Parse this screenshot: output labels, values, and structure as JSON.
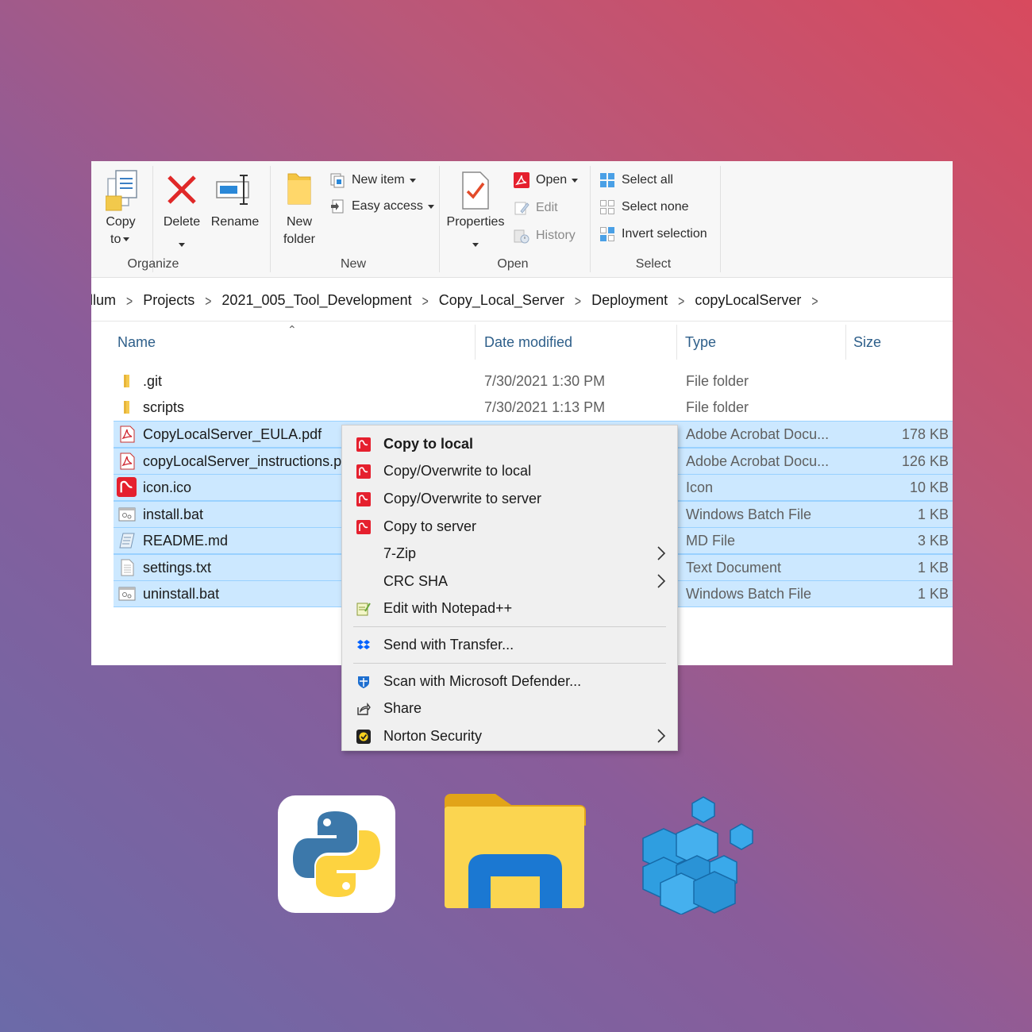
{
  "ribbon": {
    "organize": {
      "copy_to_line1": "Copy",
      "copy_to_line2": "to",
      "delete": "Delete",
      "rename": "Rename",
      "group_label": "Organize"
    },
    "new": {
      "new_item": "New item",
      "easy_access": "Easy access",
      "new_folder_line1": "New",
      "new_folder_line2": "folder",
      "group_label": "New"
    },
    "open": {
      "properties": "Properties",
      "open": "Open",
      "edit": "Edit",
      "history": "History",
      "group_label": "Open"
    },
    "select": {
      "select_all": "Select all",
      "select_none": "Select none",
      "invert_selection": "Invert selection",
      "group_label": "Select"
    }
  },
  "breadcrumb": [
    "llum",
    "Projects",
    "2021_005_Tool_Development",
    "Copy_Local_Server",
    "Deployment",
    "copyLocalServer"
  ],
  "columns": {
    "name": "Name",
    "date": "Date modified",
    "type": "Type",
    "size": "Size"
  },
  "files": [
    {
      "name": ".git",
      "date": "7/30/2021 1:30 PM",
      "type": "File folder",
      "size": "",
      "icon": "folder-icon",
      "selected": false
    },
    {
      "name": "scripts",
      "date": "7/30/2021 1:13 PM",
      "type": "File folder",
      "size": "",
      "icon": "folder-icon",
      "selected": false
    },
    {
      "name": "CopyLocalServer_EULA.pdf",
      "date": "",
      "type": "Adobe Acrobat Docu...",
      "size": "178 KB",
      "icon": "pdf-icon",
      "selected": true
    },
    {
      "name": "copyLocalServer_instructions.p",
      "date": "",
      "type": "Adobe Acrobat Docu...",
      "size": "126 KB",
      "icon": "pdf-icon",
      "selected": true
    },
    {
      "name": "icon.ico",
      "date": "",
      "type": "Icon",
      "size": "10 KB",
      "icon": "ico-icon",
      "selected": true
    },
    {
      "name": "install.bat",
      "date": "",
      "type": "Windows Batch File",
      "size": "1 KB",
      "icon": "batch-icon",
      "selected": true
    },
    {
      "name": "README.md",
      "date": "",
      "type": "MD File",
      "size": "3 KB",
      "icon": "markdown-icon",
      "selected": true
    },
    {
      "name": "settings.txt",
      "date": "",
      "type": "Text Document",
      "size": "1 KB",
      "icon": "text-icon",
      "selected": true
    },
    {
      "name": "uninstall.bat",
      "date": "",
      "type": "Windows Batch File",
      "size": "1 KB",
      "icon": "batch-icon",
      "selected": true
    }
  ],
  "context_menu": {
    "copy_to_local": "Copy to local",
    "copy_overwrite_local": "Copy/Overwrite to local",
    "copy_overwrite_server": "Copy/Overwrite to server",
    "copy_to_server": "Copy to server",
    "zip": "7-Zip",
    "crc_sha": "CRC SHA",
    "edit_notepad": "Edit with Notepad++",
    "send_transfer": "Send with Transfer...",
    "scan_defender": "Scan with Microsoft Defender...",
    "share": "Share",
    "norton": "Norton Security"
  },
  "colors": {
    "selection": "#cce8ff",
    "selection_border": "#99d1ff",
    "column_header": "#2e5f8a",
    "app_red": "#e5202e"
  },
  "bottom_icons": [
    "python-icon",
    "file-explorer-icon",
    "registry-editor-icon"
  ]
}
